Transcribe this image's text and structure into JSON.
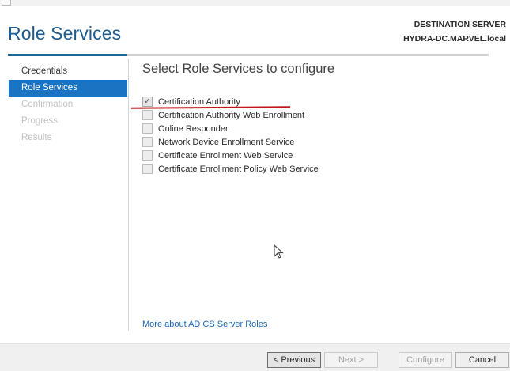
{
  "wizard": {
    "title": "Role Services",
    "destination_label": "DESTINATION SERVER",
    "destination_server": "HYDRA-DC.MARVEL.local"
  },
  "nav": {
    "items": [
      {
        "label": "Credentials",
        "state": "normal"
      },
      {
        "label": "Role Services",
        "state": "active"
      },
      {
        "label": "Confirmation",
        "state": "disabled"
      },
      {
        "label": "Progress",
        "state": "disabled"
      },
      {
        "label": "Results",
        "state": "disabled"
      }
    ]
  },
  "main": {
    "heading": "Select Role Services to configure",
    "roles": [
      {
        "label": "Certification Authority",
        "checked": true
      },
      {
        "label": "Certification Authority Web Enrollment",
        "checked": false
      },
      {
        "label": "Online Responder",
        "checked": false
      },
      {
        "label": "Network Device Enrollment Service",
        "checked": false
      },
      {
        "label": "Certificate Enrollment Web Service",
        "checked": false
      },
      {
        "label": "Certificate Enrollment Policy Web Service",
        "checked": false
      }
    ],
    "more_link": "More about AD CS Server Roles"
  },
  "footer": {
    "previous_label": "< Previous",
    "next_label": "Next >",
    "configure_label": "Configure",
    "cancel_label": "Cancel"
  },
  "colors": {
    "title_blue": "#1f5b8e",
    "nav_active": "#1b74c3",
    "annotation_red": "#c4141e"
  }
}
